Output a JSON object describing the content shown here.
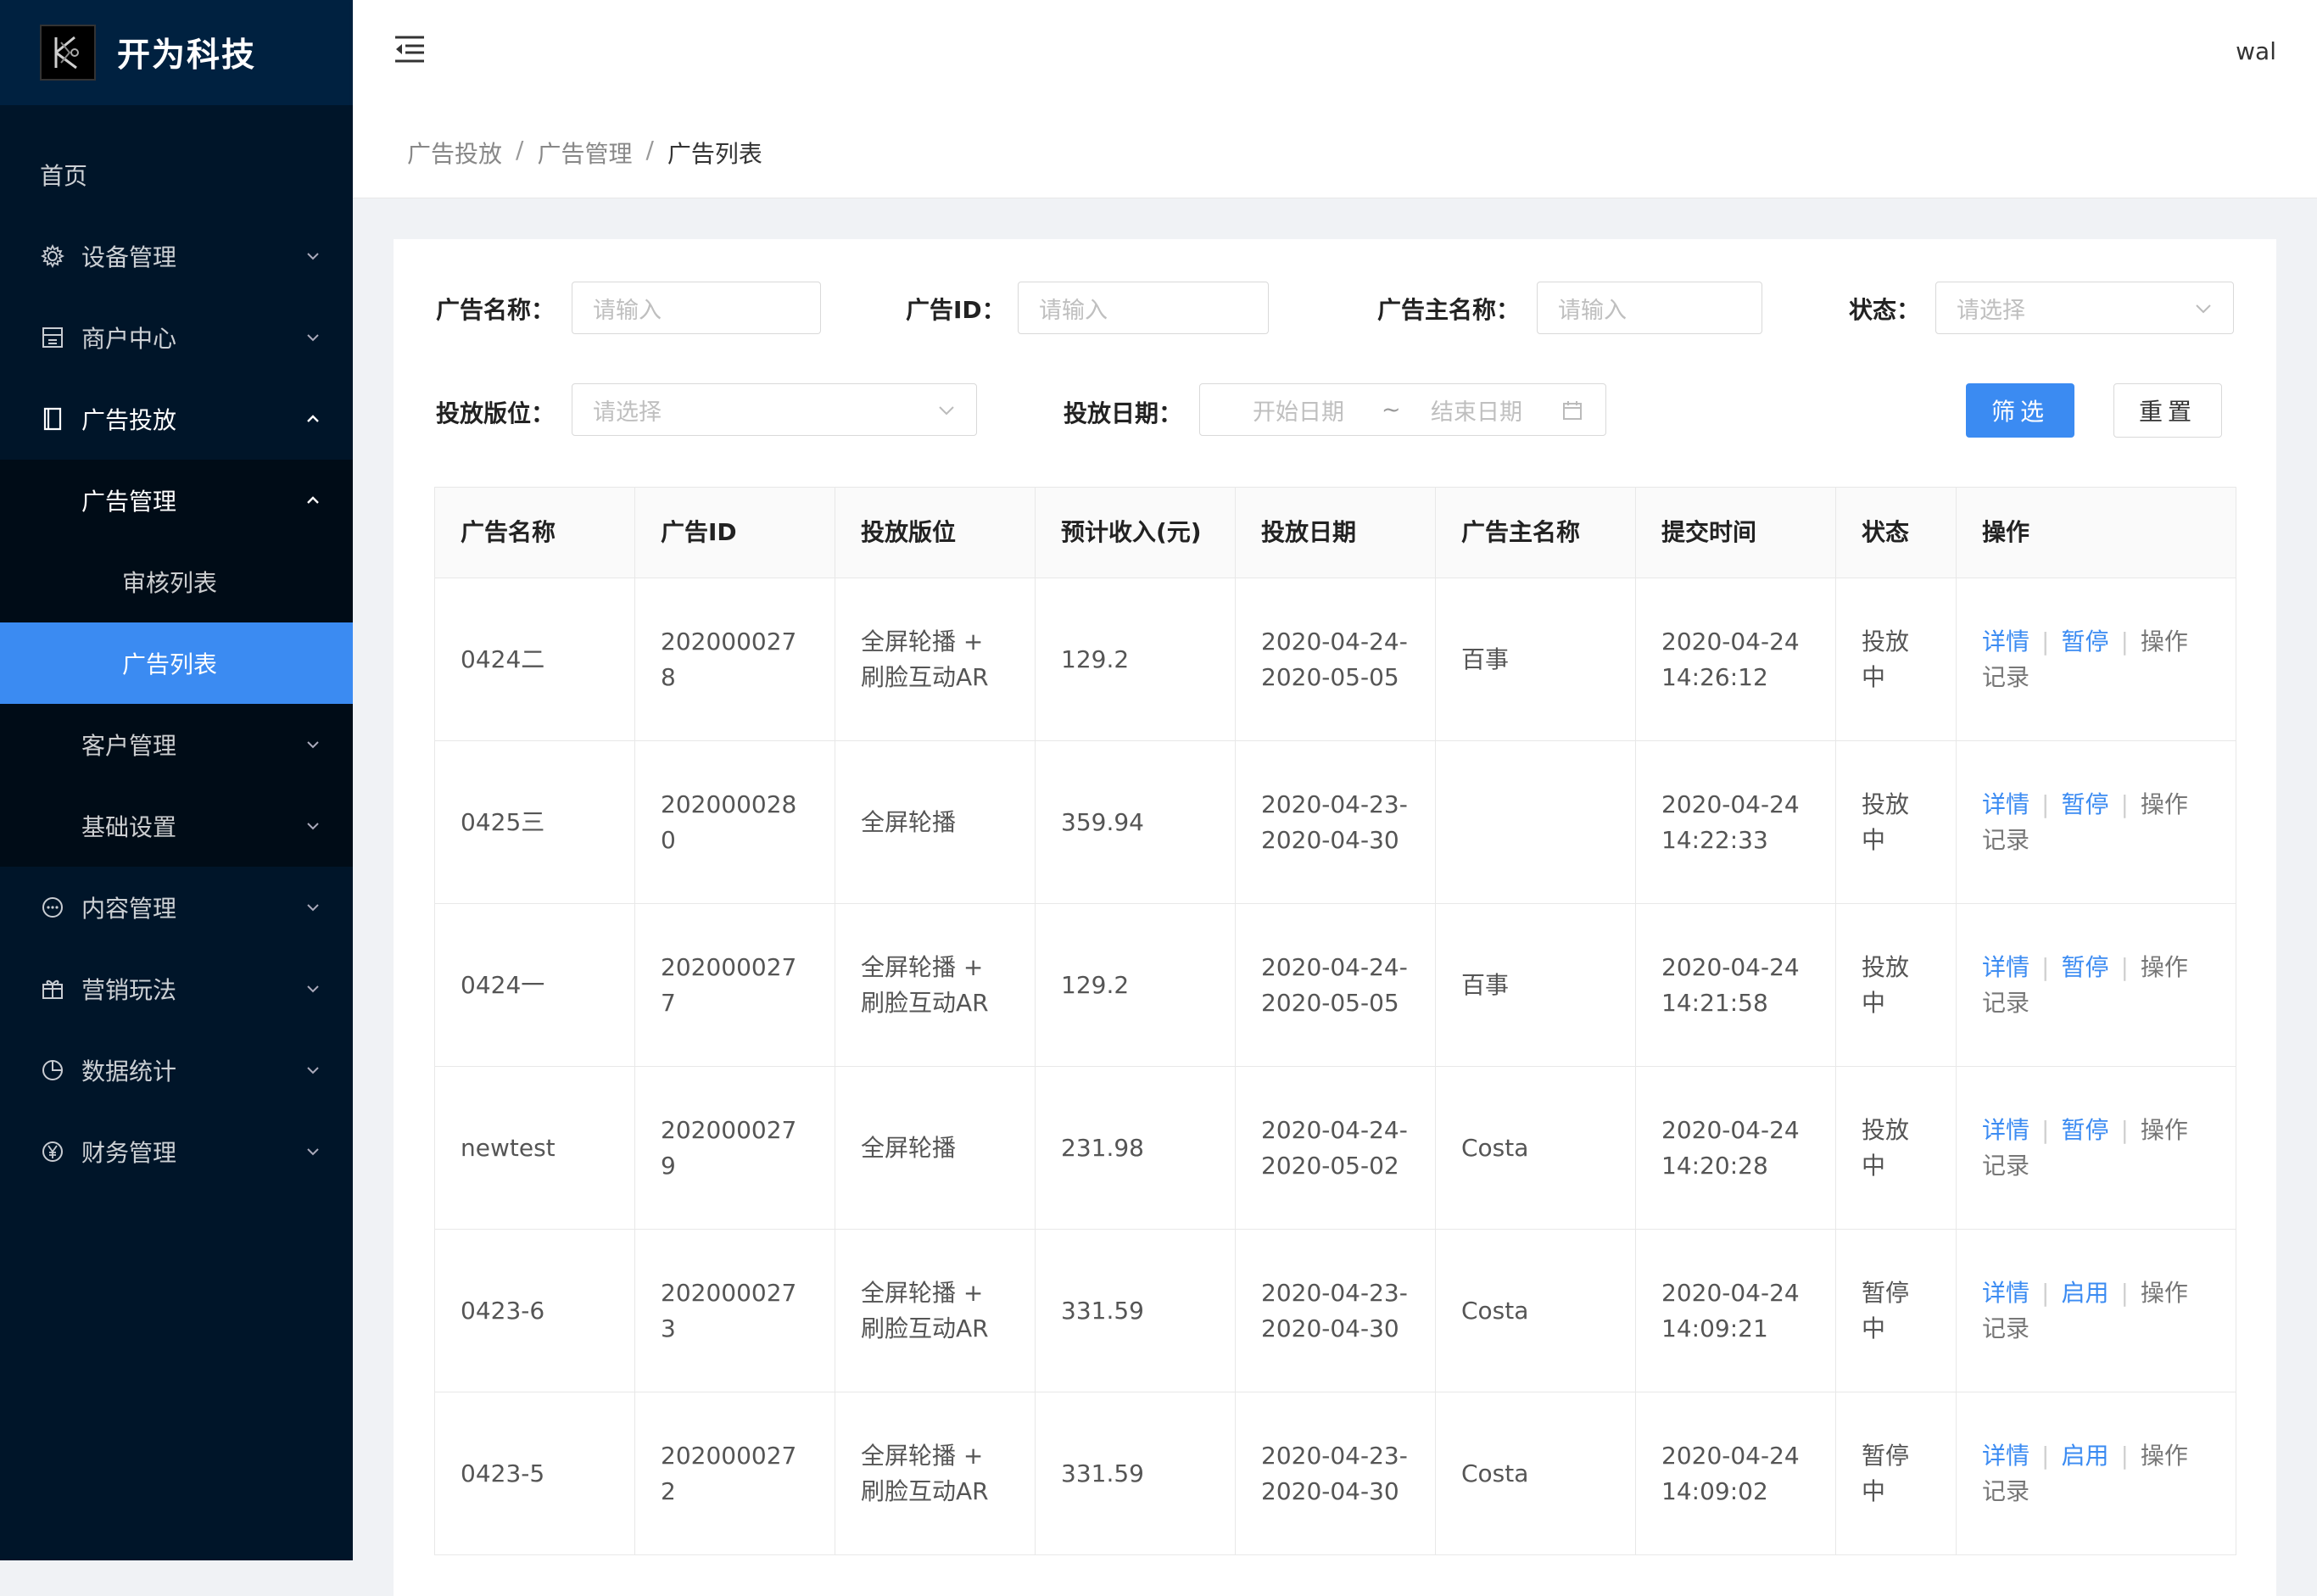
{
  "app": {
    "title": "开为科技",
    "user": "wal"
  },
  "sidebar": {
    "home": "首页",
    "items": [
      {
        "label": "设备管理",
        "icon": "gear-icon"
      },
      {
        "label": "商户中心",
        "icon": "store-icon"
      },
      {
        "label": "广告投放",
        "icon": "book-icon"
      },
      {
        "label": "内容管理",
        "icon": "message-icon"
      },
      {
        "label": "营销玩法",
        "icon": "gift-icon"
      },
      {
        "label": "数据统计",
        "icon": "pie-chart-icon"
      },
      {
        "label": "财务管理",
        "icon": "yuan-icon"
      }
    ],
    "ad_sub": {
      "ad_manage": "广告管理",
      "review_list": "审核列表",
      "ad_list": "广告列表",
      "customer_manage": "客户管理",
      "basic_settings": "基础设置"
    },
    "active_color": "#3b8bf2"
  },
  "breadcrumb": [
    "广告投放",
    "广告管理",
    "广告列表"
  ],
  "filters": {
    "ad_name": {
      "label": "广告名称：",
      "placeholder": "请输入"
    },
    "ad_id": {
      "label": "广告ID：",
      "placeholder": "请输入"
    },
    "advertiser": {
      "label": "广告主名称：",
      "placeholder": "请输入"
    },
    "status": {
      "label": "状态：",
      "placeholder": "请选择"
    },
    "slot": {
      "label": "投放版位：",
      "placeholder": "请选择"
    },
    "date": {
      "label": "投放日期：",
      "start": "开始日期",
      "sep": "~",
      "end": "结束日期"
    },
    "filter_btn": "筛选",
    "reset_btn": "重置"
  },
  "table": {
    "headers": [
      "广告名称",
      "广告ID",
      "投放版位",
      "预计收入(元)",
      "投放日期",
      "广告主名称",
      "提交时间",
      "状态",
      "操作"
    ],
    "rows": [
      {
        "name": "0424二",
        "id": "2020000278",
        "slot": "全屏轮播 + 刷脸互动AR",
        "income": "129.2",
        "date": "2020-04-24-2020-05-05",
        "advertiser": "百事",
        "submitted": "2020-04-24 14:26:12",
        "status": "投放中",
        "paused": false,
        "op1": "详情",
        "op2": "暂停",
        "op3": "操作记录"
      },
      {
        "name": "0425三",
        "id": "2020000280",
        "slot": "全屏轮播",
        "income": "359.94",
        "date": "2020-04-23-2020-04-30",
        "advertiser": "",
        "submitted": "2020-04-24 14:22:33",
        "status": "投放中",
        "paused": false,
        "op1": "详情",
        "op2": "暂停",
        "op3": "操作记录"
      },
      {
        "name": "0424一",
        "id": "2020000277",
        "slot": "全屏轮播 + 刷脸互动AR",
        "income": "129.2",
        "date": "2020-04-24-2020-05-05",
        "advertiser": "百事",
        "submitted": "2020-04-24 14:21:58",
        "status": "投放中",
        "paused": false,
        "op1": "详情",
        "op2": "暂停",
        "op3": "操作记录"
      },
      {
        "name": "newtest",
        "id": "2020000279",
        "slot": "全屏轮播",
        "income": "231.98",
        "date": "2020-04-24-2020-05-02",
        "advertiser": "Costa",
        "submitted": "2020-04-24 14:20:28",
        "status": "投放中",
        "paused": false,
        "op1": "详情",
        "op2": "暂停",
        "op3": "操作记录"
      },
      {
        "name": "0423-6",
        "id": "2020000273",
        "slot": "全屏轮播 + 刷脸互动AR",
        "income": "331.59",
        "date": "2020-04-23-2020-04-30",
        "advertiser": "Costa",
        "submitted": "2020-04-24 14:09:21",
        "status": "暂停中",
        "paused": true,
        "op1": "详情",
        "op2": "启用",
        "op3": "操作记录"
      },
      {
        "name": "0423-5",
        "id": "2020000272",
        "slot": "全屏轮播 + 刷脸互动AR",
        "income": "331.59",
        "date": "2020-04-23-2020-04-30",
        "advertiser": "Costa",
        "submitted": "2020-04-24 14:09:02",
        "status": "暂停中",
        "paused": true,
        "op1": "详情",
        "op2": "启用",
        "op3": "操作记录"
      }
    ]
  }
}
